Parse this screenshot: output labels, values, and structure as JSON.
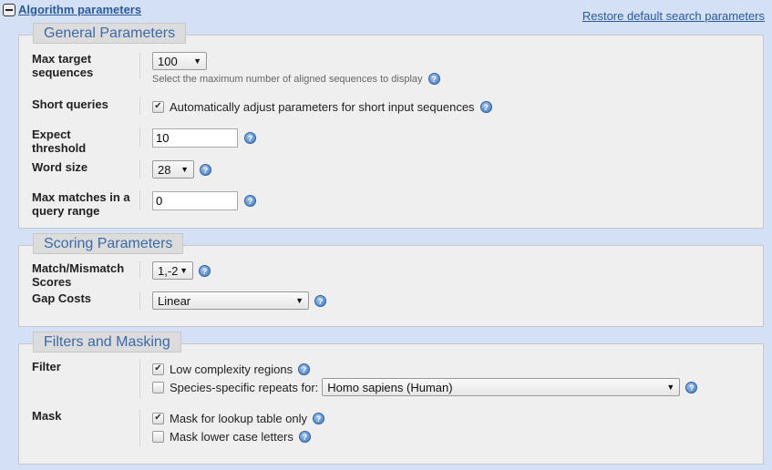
{
  "header": {
    "title": "Algorithm parameters",
    "restore_link": "Restore default search parameters"
  },
  "general": {
    "legend": "General Parameters",
    "max_target": {
      "label": "Max target sequences",
      "value": "100",
      "hint": "Select the maximum number of aligned sequences to display"
    },
    "short_queries": {
      "label": "Short queries",
      "checked": true,
      "text": "Automatically adjust parameters for short input sequences"
    },
    "expect": {
      "label": "Expect threshold",
      "value": "10"
    },
    "word_size": {
      "label": "Word size",
      "value": "28"
    },
    "max_matches": {
      "label": "Max matches in a query range",
      "value": "0"
    }
  },
  "scoring": {
    "legend": "Scoring Parameters",
    "match_mismatch": {
      "label": "Match/Mismatch Scores",
      "value": "1,-2"
    },
    "gap_costs": {
      "label": "Gap Costs",
      "value": "Linear"
    }
  },
  "filters": {
    "legend": "Filters and Masking",
    "filter_label": "Filter",
    "low_complexity": {
      "text": "Low complexity regions",
      "checked": true
    },
    "species_repeats": {
      "text": "Species-specific repeats for:",
      "checked": false,
      "value": "Homo sapiens (Human)"
    },
    "mask_label": "Mask",
    "mask_lookup": {
      "text": "Mask for lookup table only",
      "checked": true
    },
    "mask_lower": {
      "text": "Mask lower case letters",
      "checked": false
    }
  },
  "icons": {
    "help": "?",
    "check": "✔",
    "arrow": "▼"
  }
}
